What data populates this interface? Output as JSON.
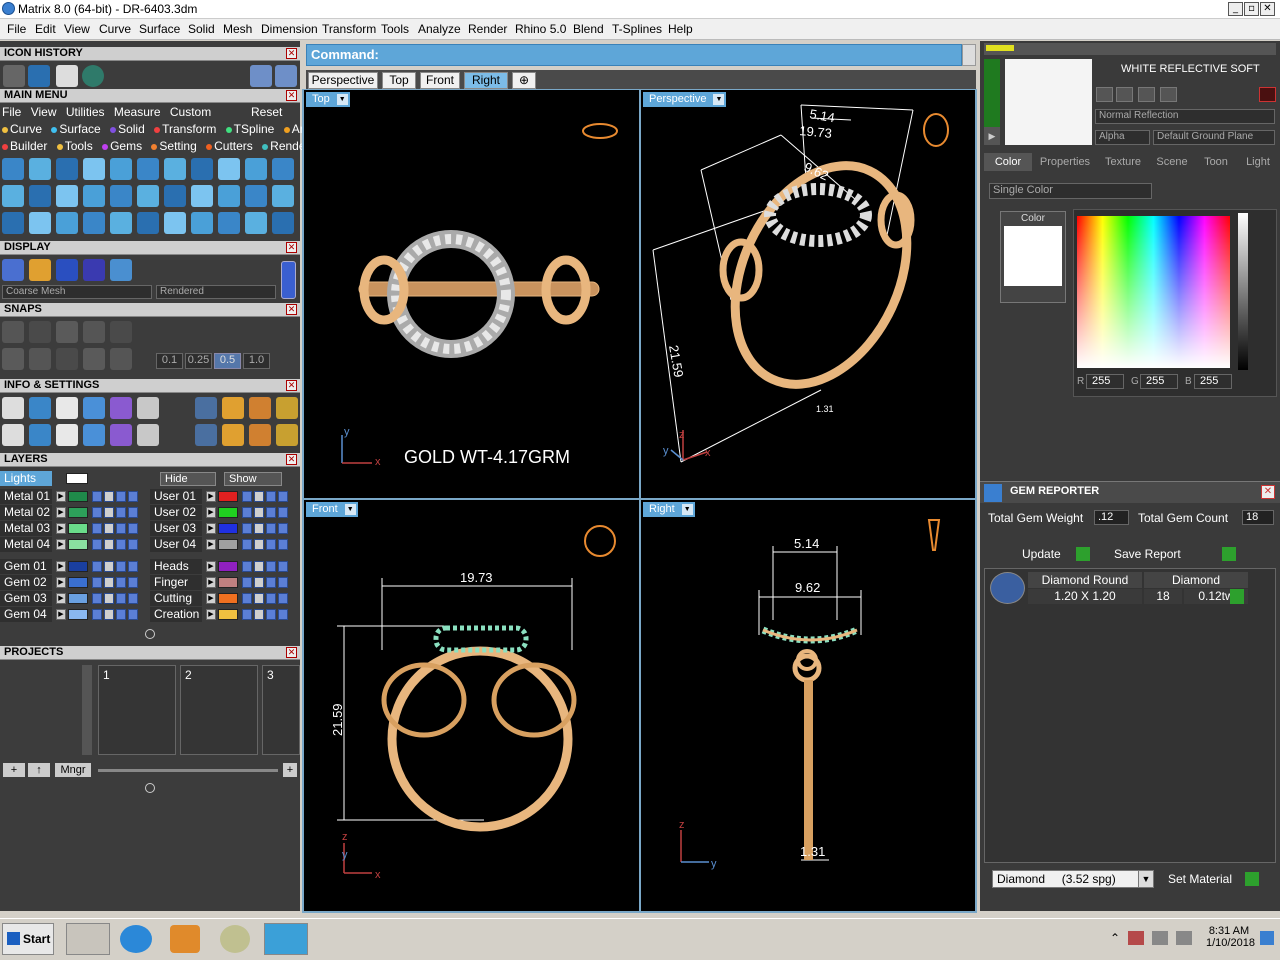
{
  "window": {
    "title": "Matrix 8.0 (64-bit) - DR-6403.3dm"
  },
  "menubar": [
    "File",
    "Edit",
    "View",
    "Curve",
    "Surface",
    "Solid",
    "Mesh",
    "Dimension",
    "Transform",
    "Tools",
    "Analyze",
    "Render",
    "Rhino 5.0",
    "Blend",
    "T-Splines",
    "Help"
  ],
  "left": {
    "icon_history": "ICON HISTORY",
    "main_menu": "MAIN MENU",
    "main_menu_row1": [
      "File",
      "View",
      "Utilities",
      "Measure",
      "Custom"
    ],
    "reset": "Reset",
    "main_menu_row2": [
      "Curve",
      "Surface",
      "Solid",
      "Transform",
      "TSpline",
      "Art"
    ],
    "main_menu_row3": [
      "Builder",
      "Tools",
      "Gems",
      "Setting",
      "Cutters",
      "Render"
    ],
    "display": "DISPLAY",
    "mesh_select": "Coarse Mesh",
    "render_select": "Rendered",
    "snaps": "SNAPS",
    "snap_values": [
      "0.1",
      "0.25",
      "0.5",
      "1.0"
    ],
    "info_settings": "INFO & SETTINGS",
    "layers": "LAYERS",
    "lights": "Lights",
    "hide": "Hide",
    "show": "Show",
    "layers_left": [
      "Metal 01",
      "Metal 02",
      "Metal 03",
      "Metal 04",
      "Gem 01",
      "Gem 02",
      "Gem 03",
      "Gem 04"
    ],
    "layers_right": [
      "User 01",
      "User 02",
      "User 03",
      "User 04",
      "Heads",
      "Finger",
      "Cutting",
      "Creation"
    ],
    "projects": "PROJECTS",
    "project_slots": [
      "1",
      "2",
      "3"
    ],
    "mngr": "Mngr"
  },
  "command": {
    "label": "Command:"
  },
  "tabs": [
    "Perspective",
    "Top",
    "Front",
    "Right"
  ],
  "viewports": {
    "top": {
      "name": "Top",
      "gold_weight": "GOLD WT-4.17GRM",
      "axis_y": "y",
      "axis_x": "x"
    },
    "perspective": {
      "name": "Perspective",
      "dims": [
        "5.14",
        "19.73",
        "9.62",
        "21.59",
        "1.31"
      ],
      "axis_z": "z",
      "axis_y": "y",
      "axis_x": "x"
    },
    "front": {
      "name": "Front",
      "dims": [
        "19.73",
        "21.59"
      ],
      "axis_z": "z",
      "axis_y": "y",
      "axis_x": "x"
    },
    "right": {
      "name": "Right",
      "dims": [
        "5.14",
        "9.62",
        "1.31"
      ],
      "axis_z": "z",
      "axis_y": "y"
    }
  },
  "material": {
    "name": "WHITE REFLECTIVE SOFT",
    "reflection": "Normal Reflection",
    "alpha": "Alpha",
    "ground": "Default Ground Plane",
    "tabs": [
      "Color",
      "Properties",
      "Texture",
      "Scene",
      "Toon",
      "Light"
    ],
    "color_mode": "Single Color",
    "color_label": "Color",
    "r_label": "R",
    "g_label": "G",
    "b_label": "B",
    "r": "255",
    "g": "255",
    "b": "255"
  },
  "gem_reporter": {
    "title": "GEM REPORTER",
    "total_weight_label": "Total Gem Weight",
    "total_weight": ".12",
    "total_count_label": "Total Gem Count",
    "total_count": "18",
    "update": "Update",
    "save_report": "Save Report",
    "col1": "Diamond Round",
    "col2": "Diamond",
    "size": "1.20 X 1.20",
    "count": "18",
    "tw": "0.12tw",
    "material_select": "Diamond     (3.52 spg)",
    "set_material": "Set Material"
  },
  "taskbar": {
    "start": "Start",
    "time": "8:31 AM",
    "date": "1/10/2018"
  },
  "colors": {
    "accent": "#5ea6d8",
    "gold": "#e8b67e",
    "panel": "#3c3c3c"
  }
}
